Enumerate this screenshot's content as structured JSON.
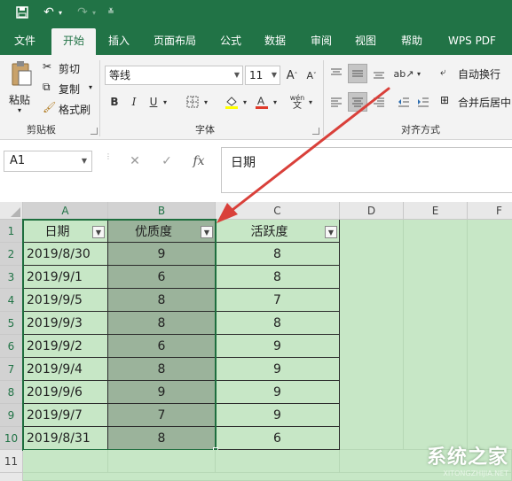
{
  "titlebar": {
    "bg": "#217346",
    "icons": [
      "save-icon",
      "undo-icon",
      "undo-dropdown-icon",
      "redo-icon",
      "redo-dropdown-icon",
      "customize-qat-icon"
    ]
  },
  "tabs": [
    {
      "label": "文件"
    },
    {
      "label": "开始",
      "active": true
    },
    {
      "label": "插入"
    },
    {
      "label": "页面布局"
    },
    {
      "label": "公式"
    },
    {
      "label": "数据"
    },
    {
      "label": "审阅"
    },
    {
      "label": "视图"
    },
    {
      "label": "帮助"
    },
    {
      "label": "WPS PDF"
    }
  ],
  "ribbon": {
    "clipboard": {
      "paste": "粘贴",
      "cut": "剪切",
      "copy": "复制",
      "format_painter": "格式刷",
      "group": "剪贴板"
    },
    "font": {
      "name": "等线",
      "size": "11",
      "group": "字体",
      "bold": "B",
      "italic": "I",
      "underline": "U",
      "wen": "wén"
    },
    "alignment": {
      "wrap": "自动换行",
      "merge": "合并后居中",
      "group": "对齐方式"
    }
  },
  "formula_bar": {
    "name_box": "A1",
    "value": "日期"
  },
  "sheet": {
    "columns": [
      "A",
      "B",
      "C",
      "D",
      "E",
      "F"
    ],
    "rows": [
      "1",
      "2",
      "3",
      "4",
      "5",
      "6",
      "7",
      "8",
      "9",
      "10",
      "11"
    ],
    "headers": [
      "日期",
      "优质度",
      "活跃度"
    ],
    "data": [
      [
        "2019/8/30",
        "9",
        "8"
      ],
      [
        "2019/9/1",
        "6",
        "8"
      ],
      [
        "2019/9/5",
        "8",
        "7"
      ],
      [
        "2019/9/3",
        "8",
        "8"
      ],
      [
        "2019/9/2",
        "6",
        "9"
      ],
      [
        "2019/9/4",
        "8",
        "9"
      ],
      [
        "2019/9/6",
        "9",
        "9"
      ],
      [
        "2019/9/7",
        "7",
        "9"
      ],
      [
        "2019/8/31",
        "8",
        "6"
      ]
    ]
  },
  "watermark": {
    "main": "系统之家",
    "sub": "XITONGZHIJIA.NET"
  },
  "colors": {
    "excel_green": "#217346",
    "cell_fill": "#c7e7c6",
    "selected_fill": "#9bb39b",
    "arrow": "#d9403a"
  }
}
